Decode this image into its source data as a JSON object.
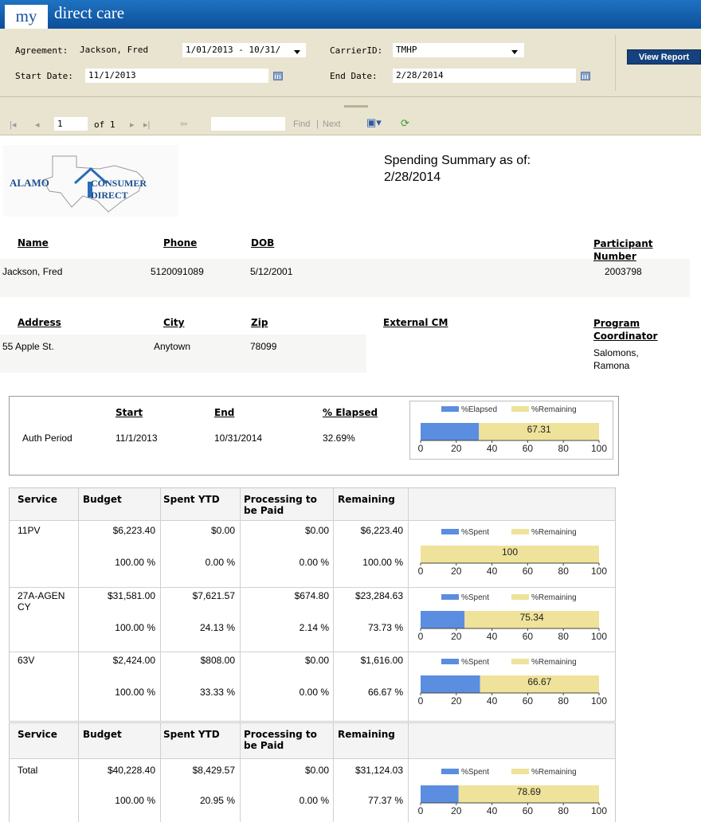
{
  "brand": {
    "my": "my",
    "name": "direct care"
  },
  "params": {
    "agreement_label": "Agreement:",
    "agreement_value": "Jackson, Fred",
    "agreement_range": "1/01/2013 - 10/31/",
    "carrier_label": "CarrierID:",
    "carrier_value": "TMHP",
    "start_label": "Start Date:",
    "start_value": "11/1/2013",
    "end_label": "End Date:",
    "end_value": "2/28/2014",
    "view_report": "View Report"
  },
  "toolbar": {
    "page": "1",
    "of": "of 1",
    "find": "Find",
    "sep": "|",
    "next": "Next",
    "search_value": ""
  },
  "report": {
    "logo_a": "ALAMO",
    "logo_b": "CONSUMER DIRECT",
    "title": "Spending Summary as of:",
    "as_of": "2/28/2014",
    "info1": {
      "h_name": "Name",
      "h_phone": "Phone",
      "h_dob": "DOB",
      "h_participant": "Participant Number",
      "name": "Jackson, Fred",
      "phone": "5120091089",
      "dob": "5/12/2001",
      "participant": "2003798"
    },
    "info2": {
      "h_address": "Address",
      "h_city": "City",
      "h_zip": "Zip",
      "h_external": "External CM",
      "h_coordinator": "Program Coordinator",
      "address": "55 Apple St.",
      "city": "Anytown",
      "zip": "78099",
      "coordinator": "Salomons, Ramona"
    },
    "auth": {
      "h_start": "Start",
      "h_end": "End",
      "h_elapsed": "% Elapsed",
      "label": "Auth Period",
      "start": "11/1/2013",
      "end": "10/31/2014",
      "elapsed": "32.69%"
    },
    "table_headers": {
      "service": "Service",
      "budget": "Budget",
      "spent": "Spent YTD",
      "processing": "Processing to be Paid",
      "remaining": "Remaining"
    },
    "services": [
      {
        "service": "11PV",
        "budget": "$6,223.40",
        "spent": "$0.00",
        "processing": "$0.00",
        "remaining": "$6,223.40",
        "budget_pct": "100.00 %",
        "spent_pct": "0.00 %",
        "processing_pct": "0.00 %",
        "remaining_pct": "100.00 %"
      },
      {
        "service": "27A-AGEN CY",
        "budget": "$31,581.00",
        "spent": "$7,621.57",
        "processing": "$674.80",
        "remaining": "$23,284.63",
        "budget_pct": "100.00 %",
        "spent_pct": "24.13 %",
        "processing_pct": "2.14 %",
        "remaining_pct": "73.73 %"
      },
      {
        "service": "63V",
        "budget": "$2,424.00",
        "spent": "$808.00",
        "processing": "$0.00",
        "remaining": "$1,616.00",
        "budget_pct": "100.00 %",
        "spent_pct": "33.33 %",
        "processing_pct": "0.00 %",
        "remaining_pct": "66.67 %"
      }
    ],
    "total": {
      "service": "Total",
      "budget": "$40,228.40",
      "spent": "$8,429.57",
      "processing": "$0.00",
      "remaining": "$31,124.03",
      "budget_pct": "100.00 %",
      "spent_pct": "20.95 %",
      "processing_pct": "0.00 %",
      "remaining_pct": "77.37 %"
    }
  },
  "colors": {
    "elapsed": "#5b8de0",
    "remaining": "#efe29a",
    "header_blue": "#1464b8"
  },
  "chart_data": [
    {
      "type": "bar",
      "orientation": "horizontal",
      "stacked": true,
      "categories": [
        "Auth Period"
      ],
      "series": [
        {
          "name": "%Elapsed",
          "values": [
            32.69
          ]
        },
        {
          "name": "%Remaining",
          "values": [
            67.31
          ]
        }
      ],
      "data_labels": [
        "67.31"
      ],
      "xlim": [
        0,
        100
      ],
      "ticks": [
        "0",
        "20",
        "40",
        "60",
        "80",
        "100"
      ],
      "legend": "top"
    },
    {
      "type": "bar",
      "orientation": "horizontal",
      "stacked": true,
      "categories": [
        "11PV"
      ],
      "series": [
        {
          "name": "%Spent",
          "values": [
            0
          ]
        },
        {
          "name": "%Remaining",
          "values": [
            100
          ]
        }
      ],
      "data_labels": [
        "100"
      ],
      "xlim": [
        0,
        100
      ],
      "ticks": [
        "0",
        "20",
        "40",
        "60",
        "80",
        "100"
      ],
      "legend": "top"
    },
    {
      "type": "bar",
      "orientation": "horizontal",
      "stacked": true,
      "categories": [
        "27A-AGENCY"
      ],
      "series": [
        {
          "name": "%Spent",
          "values": [
            24.66
          ]
        },
        {
          "name": "%Remaining",
          "values": [
            75.34
          ]
        }
      ],
      "data_labels": [
        "75.34"
      ],
      "xlim": [
        0,
        100
      ],
      "ticks": [
        "0",
        "20",
        "40",
        "60",
        "80",
        "100"
      ],
      "legend": "top"
    },
    {
      "type": "bar",
      "orientation": "horizontal",
      "stacked": true,
      "categories": [
        "63V"
      ],
      "series": [
        {
          "name": "%Spent",
          "values": [
            33.33
          ]
        },
        {
          "name": "%Remaining",
          "values": [
            66.67
          ]
        }
      ],
      "data_labels": [
        "66.67"
      ],
      "xlim": [
        0,
        100
      ],
      "ticks": [
        "0",
        "20",
        "40",
        "60",
        "80",
        "100"
      ],
      "legend": "top"
    },
    {
      "type": "bar",
      "orientation": "horizontal",
      "stacked": true,
      "categories": [
        "Total"
      ],
      "series": [
        {
          "name": "%Spent",
          "values": [
            21.31
          ]
        },
        {
          "name": "%Remaining",
          "values": [
            78.69
          ]
        }
      ],
      "data_labels": [
        "78.69"
      ],
      "xlim": [
        0,
        100
      ],
      "ticks": [
        "0",
        "20",
        "40",
        "60",
        "80",
        "100"
      ],
      "legend": "top"
    }
  ]
}
